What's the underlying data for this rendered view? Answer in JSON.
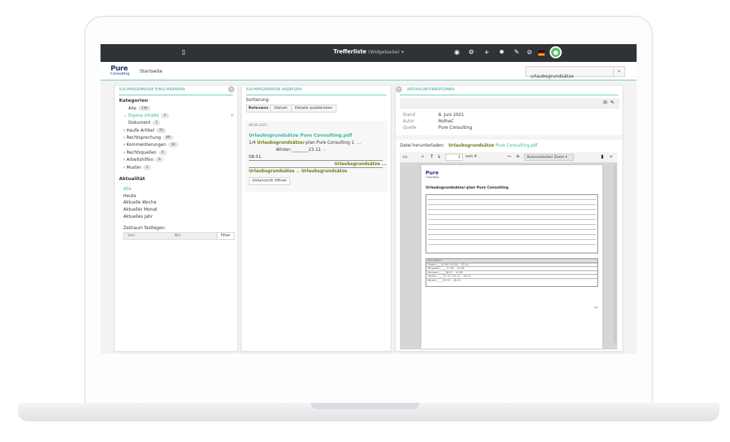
{
  "app": {
    "title": "Trefferliste",
    "subtitle": "(Widgetseite)",
    "startseite": "Startseite",
    "logo_top": "Pure",
    "logo_bottom": "Consulting"
  },
  "topbar_icons": [
    "tablet-icon",
    "eye-icon",
    "gear-icon",
    "plus-icon",
    "puzzle-icon",
    "pencil-icon",
    "compass-icon",
    "flag-de-icon",
    "user-avatar-icon"
  ],
  "search": {
    "value": "urlaubsgrundsätze"
  },
  "filter_panel": {
    "title": "SUCHERGEBNISSE EINSCHRÄNKEN",
    "kategorien_label": "Kategorien",
    "categories": [
      {
        "label": "Alle",
        "count": "136"
      },
      {
        "label": "Eigene Inhalte",
        "count": "1"
      },
      {
        "label": "Dokument",
        "count": "1"
      },
      {
        "label": "Haufe Artikel",
        "count": "25"
      },
      {
        "label": "Rechtsprechung",
        "count": "89"
      },
      {
        "label": "Kommentierungen",
        "count": "10"
      },
      {
        "label": "Rechtsquellen",
        "count": "4"
      },
      {
        "label": "Arbeitshilfen",
        "count": "6"
      },
      {
        "label": "Muster",
        "count": "1"
      }
    ],
    "aktualitaet_label": "Aktualität",
    "aktualitaet": [
      "Alle",
      "Heute",
      "Aktuelle Woche",
      "Aktueller Monat",
      "Aktuelles Jahr"
    ],
    "zeitraum_label": "Zeitraum festlegen:",
    "von": "Von",
    "bis": "Bis",
    "filter_btn": "Filter"
  },
  "results_panel": {
    "title": "SUCHERGEBNISSE ANZEIGEN",
    "sortierung": "Sortierung:",
    "sort_buttons": [
      "Relevanz",
      "Datum",
      "Details ausblenden"
    ],
    "result": {
      "date": "08.06.2021",
      "title": "Urlaubsgrundsätze Pure Consulting.pdf",
      "line1_pre": "1/4 ",
      "line1_hl": "Urlaubsgrundsätze",
      "line1_post": "/-plan Pure Consulting 1. ...",
      "line2": "Winter:________23.12. -",
      "line3": "08.01.",
      "line4_hl": "Urlaubsgrundsätze ...",
      "line5_hl_a": "Urlaubsgrundsätze",
      "line5_mid": " ... ",
      "line5_hl_b": "Urlaubsgrundsätze",
      "open_btn": "Vollansicht öffnen"
    }
  },
  "info_panel": {
    "title": "ARTIKELINFORMATIONEN",
    "stand_label": "Stand",
    "stand": "8. Juni 2021",
    "autor_label": "Autor",
    "autor": "RotheC",
    "quelle_label": "Quelle",
    "quelle": "Pure Consulting",
    "download_label": "Datei herunterladen:",
    "download_hl": "Urlaubsgrundsätze",
    "download_rest": " Pure Consulting.pdf"
  },
  "pdf_viewer": {
    "page_value": "1",
    "page_of": "von 4",
    "zoom": "Automatischer Zoom",
    "doc_title": "Urlaubsgrundsätze/-plan Pure Consulting",
    "table_header": "Schulferien",
    "table_rows": [
      "Ostern:___14.04.+19.04. - 22.04.",
      "Pfingsten:_____27.06. - 10.06.",
      "Sommer:_____28.07. - 10.09.",
      "Herbst:_____31.10.+02.11. - 06.11.",
      "Winter:_____23.12. - 08.01."
    ],
    "page_number": "1/4"
  }
}
